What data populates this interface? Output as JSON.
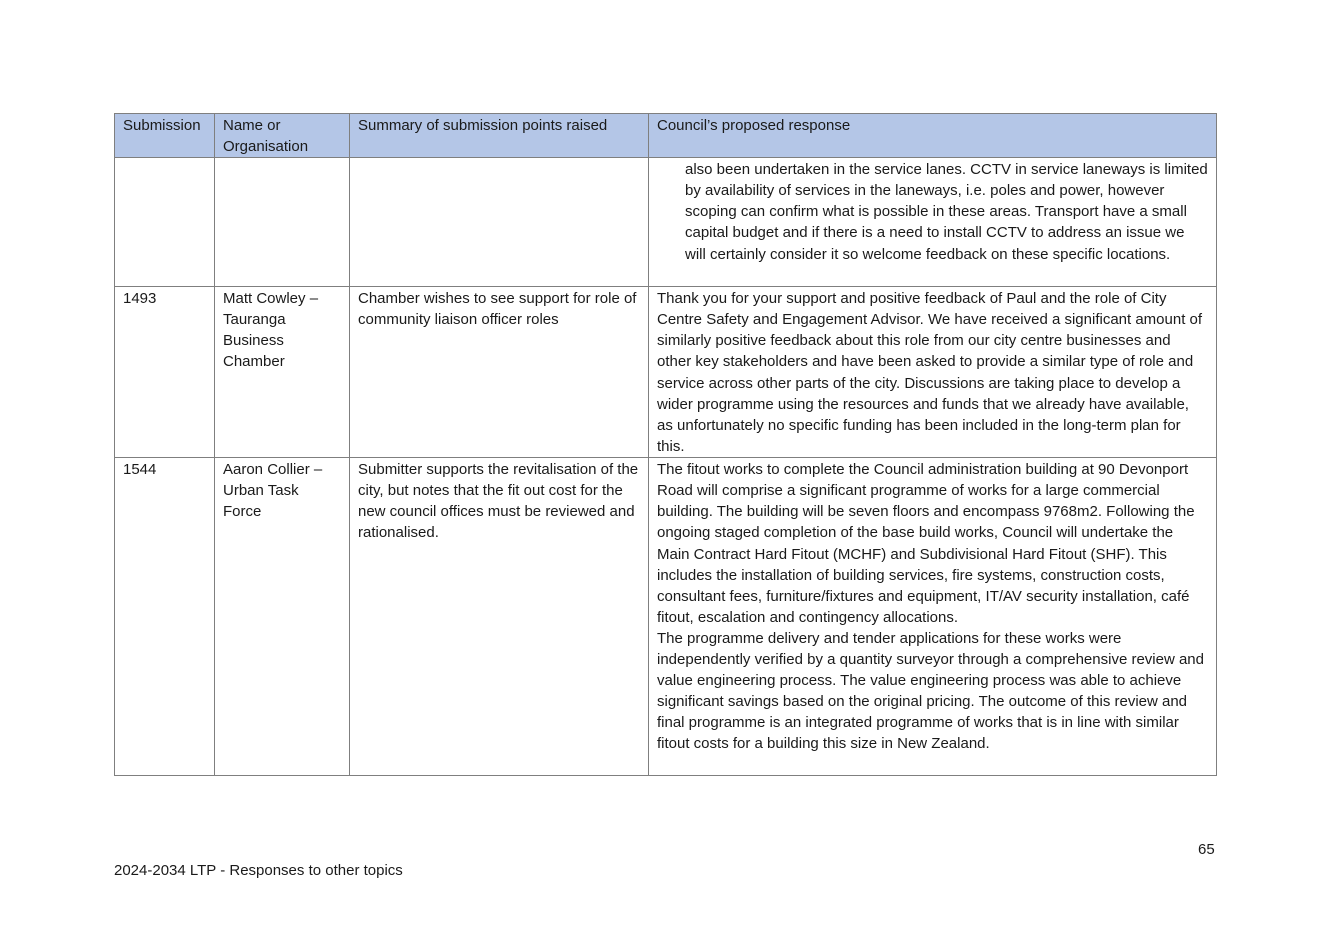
{
  "table": {
    "headers": {
      "submission": "Submission",
      "name": "Name or Organisation",
      "summary": "Summary of submission points raised",
      "response": "Council’s proposed response"
    },
    "rows": [
      {
        "submission": "",
        "name": "",
        "summary": "",
        "response": "also been undertaken in the service lanes. CCTV in service laneways is limited by availability of services in the laneways, i.e. poles and power, however scoping can confirm what is possible in these areas. Transport have a small capital budget and if there is a need to install CCTV to address an issue we will certainly consider it so welcome feedback on these specific locations."
      },
      {
        "submission": "1493",
        "name": "Matt Cowley – Tauranga Business Chamber",
        "summary": "Chamber wishes to see support for role of community liaison officer roles",
        "response": "Thank you for your support and positive feedback of Paul and the role of City Centre Safety and Engagement Advisor. We have received a significant amount of similarly positive feedback about this role from our city centre businesses and other key stakeholders and have been asked to provide a similar type of role and service across other parts of the city. Discussions are taking place to develop a wider programme using the resources and funds that we already have available, as unfortunately no specific funding has been included in the long-term plan for this."
      },
      {
        "submission": "1544",
        "name": "Aaron Collier – Urban Task Force",
        "summary": "Submitter supports the revitalisation of the city, but notes that the fit out cost for the new council offices must be reviewed and rationalised.",
        "response_p1": "The fitout works to complete the Council administration building at 90 Devonport Road will comprise a significant programme of works for a large commercial building. The building will be seven floors and encompass 9768m2. Following the ongoing staged completion of the base build works, Council will undertake the Main Contract Hard Fitout (MCHF) and Subdivisional Hard Fitout (SHF). This includes the installation of building services, fire systems, construction costs, consultant fees, furniture/fixtures and equipment, IT/AV security installation, café fitout, escalation and contingency allocations.",
        "response_p2": "The programme delivery and tender applications for these works were independently verified by a quantity surveyor through a comprehensive review and value engineering process. The value engineering process was able to achieve significant savings based on the original pricing. The outcome of this review and final programme is an integrated programme of works that is in line with similar fitout costs for a building this size in New Zealand."
      }
    ]
  },
  "footer": {
    "document_title": "2024-2034 LTP - Responses to other topics",
    "page_number": "65"
  },
  "colors": {
    "header_background": "#b4c6e7",
    "border": "#7f7f7f"
  }
}
